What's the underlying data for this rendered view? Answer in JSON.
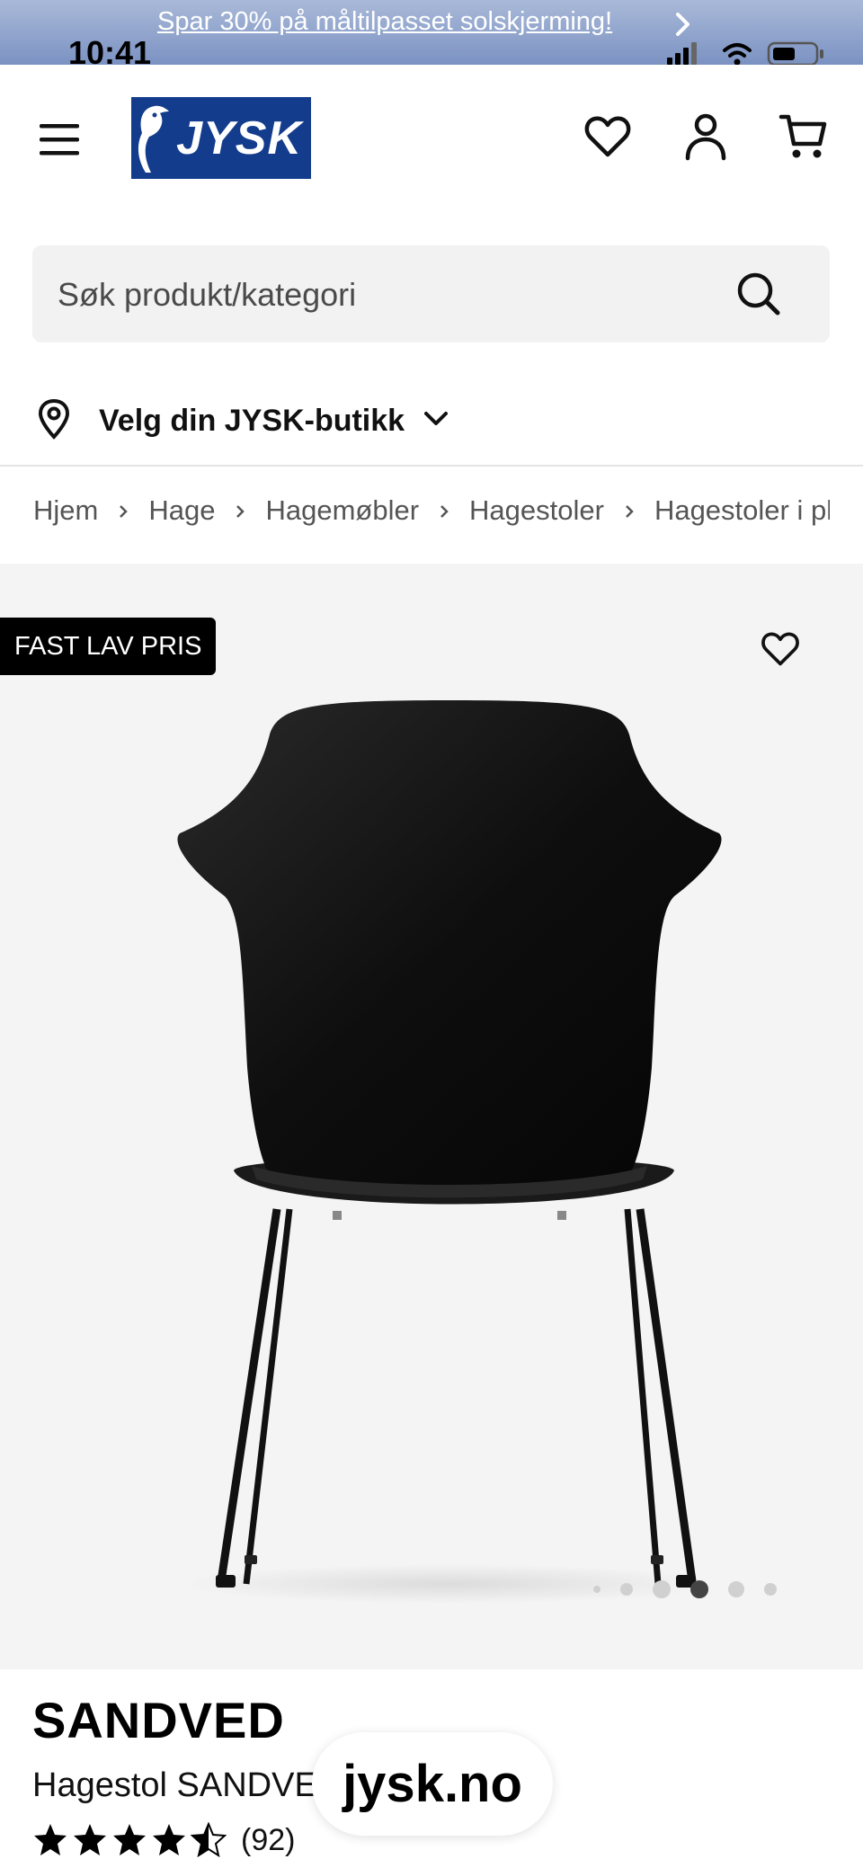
{
  "promo": {
    "text": "Spar 30% på måltilpasset solskjerming!"
  },
  "status_bar": {
    "time": "10:41"
  },
  "header": {
    "logo_text": "JYSK",
    "icons": [
      "menu-icon",
      "heart-icon",
      "user-icon",
      "cart-icon"
    ]
  },
  "search": {
    "placeholder": "Søk produkt/kategori"
  },
  "store": {
    "label": "Velg din JYSK-butikk"
  },
  "breadcrumb": [
    "Hjem",
    "Hage",
    "Hagemøbler",
    "Hagestoler",
    "Hagestoler i pla"
  ],
  "product": {
    "badge": "FAST LAV PRIS",
    "title": "SANDVED",
    "subtitle": "Hagestol SANDVE",
    "rating_count": "(92)",
    "rating_stars": 4.5,
    "image_count": 6,
    "active_image": 4
  },
  "browser": {
    "url": "jysk.no"
  },
  "colors": {
    "brand_blue": "#143c8c",
    "badge_bg": "#000000",
    "gallery_bg": "#f4f4f4"
  }
}
